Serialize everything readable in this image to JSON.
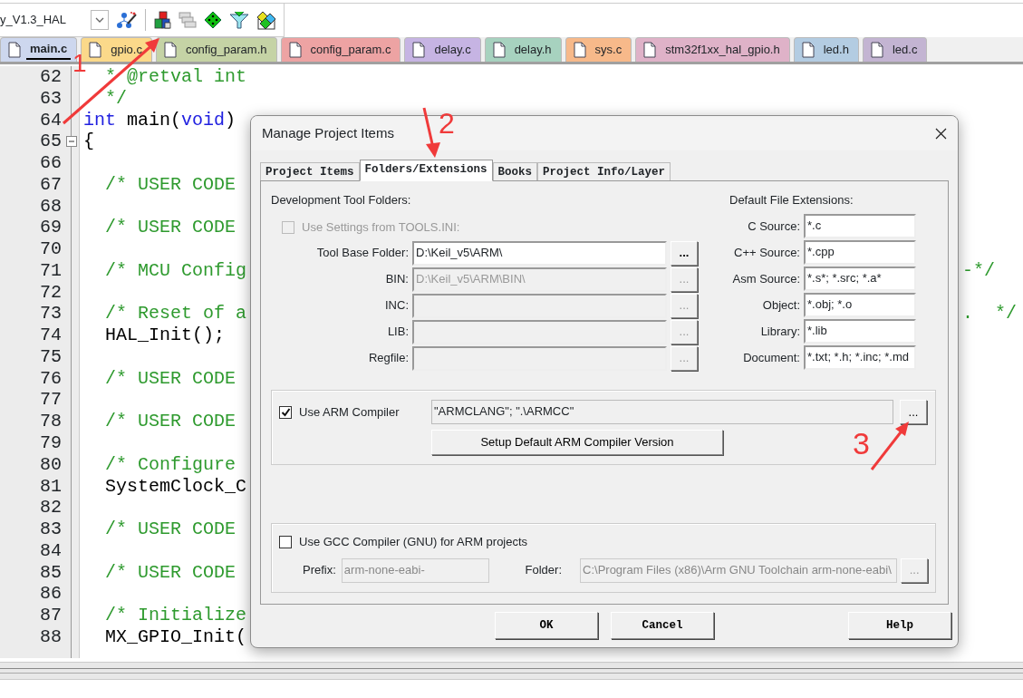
{
  "toolbar": {
    "project": "y_V1.3_HAL"
  },
  "file_tabs": [
    {
      "label": "main.c",
      "selected": true,
      "color": "#cdd7ee"
    },
    {
      "label": "gpio.c",
      "selected": false,
      "color": "#fbd98a"
    },
    {
      "label": "config_param.h",
      "selected": false,
      "color": "#c5d3a5"
    },
    {
      "label": "config_param.c",
      "selected": false,
      "color": "#eda3a3"
    },
    {
      "label": "delay.c",
      "selected": false,
      "color": "#c6b4e3"
    },
    {
      "label": "delay.h",
      "selected": false,
      "color": "#a7d2bf"
    },
    {
      "label": "sys.c",
      "selected": false,
      "color": "#f7b98a"
    },
    {
      "label": "stm32f1xx_hal_gpio.h",
      "selected": false,
      "color": "#dfb2c8"
    },
    {
      "label": "led.h",
      "selected": false,
      "color": "#b3cce2"
    },
    {
      "label": "led.c",
      "selected": false,
      "color": "#c3b4d2"
    }
  ],
  "editor": {
    "lines": [
      {
        "number": "62",
        "foldable": false,
        "tokens": [
          {
            "text": "  * @retval int",
            "kind": "comment"
          }
        ]
      },
      {
        "number": "63",
        "foldable": false,
        "tokens": [
          {
            "text": "  */",
            "kind": "comment"
          }
        ]
      },
      {
        "number": "64",
        "foldable": false,
        "tokens": [
          {
            "text": "int",
            "kind": "keyword"
          },
          {
            "text": " main(",
            "kind": "plain"
          },
          {
            "text": "void",
            "kind": "keyword"
          },
          {
            "text": ")",
            "kind": "plain"
          }
        ]
      },
      {
        "number": "65",
        "foldable": true,
        "tokens": [
          {
            "text": "{",
            "kind": "plain"
          }
        ]
      },
      {
        "number": "66",
        "foldable": false
      },
      {
        "number": "67",
        "foldable": false,
        "tokens": [
          {
            "text": "  /* USER CODE",
            "kind": "comment"
          }
        ]
      },
      {
        "number": "68",
        "foldable": false
      },
      {
        "number": "69",
        "foldable": false,
        "tokens": [
          {
            "text": "  /* USER CODE",
            "kind": "comment"
          }
        ]
      },
      {
        "number": "70",
        "foldable": false
      },
      {
        "number": "71",
        "foldable": false,
        "tokens": [
          {
            "text": "  /* MCU Config",
            "kind": "comment"
          }
        ],
        "right_text": "-*/"
      },
      {
        "number": "72",
        "foldable": false
      },
      {
        "number": "73",
        "foldable": false,
        "tokens": [
          {
            "text": "  /* Reset of a",
            "kind": "comment"
          }
        ],
        "right_text": ".  */"
      },
      {
        "number": "74",
        "foldable": false,
        "tokens": [
          {
            "text": "  HAL_Init();",
            "kind": "plain"
          }
        ]
      },
      {
        "number": "75",
        "foldable": false
      },
      {
        "number": "76",
        "foldable": false,
        "tokens": [
          {
            "text": "  /* USER CODE",
            "kind": "comment"
          }
        ]
      },
      {
        "number": "77",
        "foldable": false
      },
      {
        "number": "78",
        "foldable": false,
        "tokens": [
          {
            "text": "  /* USER CODE",
            "kind": "comment"
          }
        ]
      },
      {
        "number": "79",
        "foldable": false
      },
      {
        "number": "80",
        "foldable": false,
        "tokens": [
          {
            "text": "  /* Configure",
            "kind": "comment"
          }
        ]
      },
      {
        "number": "81",
        "foldable": false,
        "tokens": [
          {
            "text": "  SystemClock_C",
            "kind": "plain"
          }
        ]
      },
      {
        "number": "82",
        "foldable": false
      },
      {
        "number": "83",
        "foldable": false,
        "tokens": [
          {
            "text": "  /* USER CODE",
            "kind": "comment"
          }
        ]
      },
      {
        "number": "84",
        "foldable": false
      },
      {
        "number": "85",
        "foldable": false,
        "tokens": [
          {
            "text": "  /* USER CODE",
            "kind": "comment"
          }
        ]
      },
      {
        "number": "86",
        "foldable": false
      },
      {
        "number": "87",
        "foldable": false,
        "tokens": [
          {
            "text": "  /* Initialize",
            "kind": "comment"
          }
        ]
      },
      {
        "number": "88",
        "foldable": false,
        "tokens": [
          {
            "text": "  MX_GPIO_Init(",
            "kind": "plain"
          }
        ]
      }
    ]
  },
  "dialog": {
    "title": "Manage Project Items",
    "tabs": [
      {
        "label": "Project Items",
        "selected": false
      },
      {
        "label": "Folders/Extensions",
        "selected": true
      },
      {
        "label": "Books",
        "selected": false
      },
      {
        "label": "Project Info/Layer",
        "selected": false
      }
    ],
    "folders": {
      "heading": "Development Tool Folders:",
      "use_tools_ini": {
        "label": "Use Settings from TOOLS.INI:",
        "checked": false,
        "disabled": true
      },
      "fields": [
        {
          "label": "Tool Base Folder:",
          "value": "D:\\Keil_v5\\ARM\\",
          "disabled": false,
          "button": "..."
        },
        {
          "label": "BIN:",
          "value": "D:\\Keil_v5\\ARM\\BIN\\",
          "disabled": true,
          "button": "..."
        },
        {
          "label": "INC:",
          "disabled": true,
          "button": "..."
        },
        {
          "label": "LIB:",
          "disabled": true,
          "button": "..."
        },
        {
          "label": "Regfile:",
          "disabled": true,
          "button": "..."
        }
      ]
    },
    "extensions": {
      "heading": "Default File Extensions:",
      "fields": [
        {
          "label": "C Source:",
          "value": "*.c"
        },
        {
          "label": "C++ Source:",
          "value": "*.cpp"
        },
        {
          "label": "Asm Source:",
          "value": "*.s*; *.src; *.a*"
        },
        {
          "label": "Object:",
          "value": "*.obj; *.o"
        },
        {
          "label": "Library:",
          "value": "*.lib"
        },
        {
          "label": "Document:",
          "value": "*.txt; *.h; *.inc; *.md"
        }
      ]
    },
    "arm": {
      "checkbox": {
        "label": "Use ARM Compiler",
        "checked": true
      },
      "value": "\"ARMCLANG\"; \".\\ARMCC\"",
      "button": "...",
      "setup_button": "Setup Default ARM Compiler Version"
    },
    "gcc": {
      "checkbox": {
        "label": "Use GCC Compiler (GNU) for ARM projects",
        "checked": false
      },
      "prefix_label": "Prefix:",
      "prefix": "arm-none-eabi-",
      "folder_label": "Folder:",
      "folder": "C:\\Program Files (x86)\\Arm GNU Toolchain arm-none-eabi\\",
      "button": "..."
    },
    "buttons": [
      "OK",
      "Cancel",
      "Help"
    ]
  },
  "annotations": [
    {
      "label": "1"
    },
    {
      "label": "2"
    },
    {
      "label": "3"
    }
  ]
}
